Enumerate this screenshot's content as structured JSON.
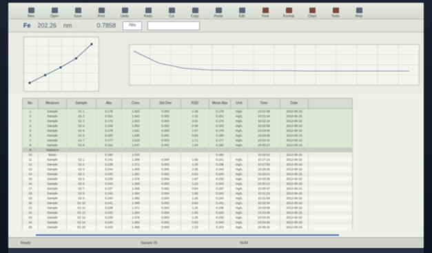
{
  "toolbar": {
    "tools": [
      {
        "label": "New",
        "icon": "new-icon"
      },
      {
        "label": "Open",
        "icon": "open-icon"
      },
      {
        "label": "Save",
        "icon": "save-icon"
      },
      {
        "label": "Print",
        "icon": "print-icon"
      },
      {
        "label": "Undo",
        "icon": "undo-icon"
      },
      {
        "label": "Redo",
        "icon": "redo-icon"
      },
      {
        "label": "Cut",
        "icon": "cut-icon"
      },
      {
        "label": "Copy",
        "icon": "copy-icon"
      },
      {
        "label": "Paste",
        "icon": "paste-icon"
      },
      {
        "label": "Edit",
        "icon": "edit-icon"
      },
      {
        "label": "Find",
        "icon": "find-icon"
      },
      {
        "label": "Format",
        "icon": "format-icon"
      },
      {
        "label": "Chart",
        "icon": "chart-icon"
      },
      {
        "label": "Tools",
        "icon": "tools-icon"
      },
      {
        "label": "Help",
        "icon": "help-icon"
      }
    ]
  },
  "formula": {
    "cell": "Fe",
    "value1": "202.26",
    "unit": "nm",
    "value2": "0.7858",
    "box": "Abs"
  },
  "chart1": {
    "points": [
      [
        1,
        1.2
      ],
      [
        2,
        1.8
      ],
      [
        3,
        2.4
      ],
      [
        4,
        3.1
      ],
      [
        5,
        4.2
      ]
    ]
  },
  "chart2": {
    "points": [
      [
        0,
        0.9
      ],
      [
        1,
        0.55
      ],
      [
        2,
        0.4
      ],
      [
        3,
        0.35
      ],
      [
        4,
        0.34
      ],
      [
        5,
        0.33
      ],
      [
        6,
        0.33
      ],
      [
        7,
        0.32
      ],
      [
        8,
        0.32
      ],
      [
        9,
        0.32
      ],
      [
        10,
        0.32
      ],
      [
        11,
        0.32
      ]
    ]
  },
  "table": {
    "headers": [
      "No.",
      "Measure",
      "Sample",
      "Abs",
      "Conc",
      "Std Dev",
      "RSD",
      "Mean Abs",
      "Unit",
      "Time",
      "Date"
    ],
    "rows": [
      [
        "1",
        "Sample",
        "S1 1",
        "0.178",
        "1.025",
        "0.003",
        "1.45",
        "0.178",
        "mg/L",
        "10:21:08",
        "2012-06-15"
      ],
      [
        "2",
        "Sample",
        "S1 2",
        "0.181",
        "1.042",
        "0.002",
        "1.12",
        "0.181",
        "mg/L",
        "10:21:44",
        "2012-06-15"
      ],
      [
        "3",
        "Sample",
        "S1 3",
        "0.176",
        "1.013",
        "0.004",
        "2.01",
        "0.176",
        "mg/L",
        "10:22:19",
        "2012-06-15"
      ],
      [
        "4",
        "Sample",
        "S1 4",
        "0.183",
        "1.053",
        "0.002",
        "0.98",
        "0.183",
        "mg/L",
        "10:22:55",
        "2012-06-15"
      ],
      [
        "5",
        "Sample",
        "S1 5",
        "0.179",
        "1.031",
        "0.003",
        "1.57",
        "0.179",
        "mg/L",
        "10:23:30",
        "2012-06-15"
      ],
      [
        "6",
        "Sample",
        "S1 6",
        "0.180",
        "1.036",
        "0.001",
        "0.66",
        "0.180",
        "mg/L",
        "10:24:06",
        "2012-06-15"
      ],
      [
        "7",
        "Sample",
        "S1 7",
        "0.177",
        "1.019",
        "0.003",
        "1.71",
        "0.177",
        "mg/L",
        "10:24:41",
        "2012-06-15"
      ],
      [
        "8",
        "Sample",
        "S1 8",
        "0.182",
        "1.047",
        "0.002",
        "1.08",
        "0.182",
        "mg/L",
        "10:25:17",
        "2012-06-15"
      ],
      [
        "9",
        "Statistics",
        "",
        "",
        "",
        "",
        "",
        "",
        "",
        "",
        ""
      ],
      [
        "10",
        "Mean",
        "",
        "0.180",
        "1.033",
        "",
        "",
        "0.180",
        "",
        "10:26:02",
        "2012-06-15"
      ],
      [
        "11",
        "Sample",
        "S2 1",
        "0.241",
        "1.388",
        "0.004",
        "1.66",
        "0.241",
        "mg/L",
        "10:27:14",
        "2012-06-15"
      ],
      [
        "12",
        "Sample",
        "S2 2",
        "0.238",
        "1.371",
        "0.003",
        "1.26",
        "0.238",
        "mg/L",
        "10:27:50",
        "2012-06-15"
      ],
      [
        "13",
        "Sample",
        "S2 3",
        "0.244",
        "1.405",
        "0.005",
        "2.05",
        "0.244",
        "mg/L",
        "10:28:25",
        "2012-06-15"
      ],
      [
        "14",
        "Sample",
        "S2 4",
        "0.240",
        "1.382",
        "0.002",
        "0.83",
        "0.240",
        "mg/L",
        "10:29:01",
        "2012-06-15"
      ],
      [
        "15",
        "Sample",
        "S2 5",
        "0.239",
        "1.376",
        "0.004",
        "1.67",
        "0.239",
        "mg/L",
        "10:29:36",
        "2012-06-15"
      ],
      [
        "16",
        "Sample",
        "S2 6",
        "0.243",
        "1.399",
        "0.003",
        "1.23",
        "0.243",
        "mg/L",
        "10:30:12",
        "2012-06-15"
      ],
      [
        "17",
        "Sample",
        "S2 7",
        "0.237",
        "1.365",
        "0.002",
        "0.84",
        "0.237",
        "mg/L",
        "10:30:47",
        "2012-06-15"
      ],
      [
        "18",
        "Sample",
        "S2 8",
        "0.242",
        "1.394",
        "0.004",
        "1.65",
        "0.242",
        "mg/L",
        "10:31:23",
        "2012-06-15"
      ],
      [
        "19",
        "Sample",
        "S2 9",
        "0.240",
        "1.382",
        "0.003",
        "1.25",
        "0.240",
        "mg/L",
        "10:31:58",
        "2012-06-15"
      ],
      [
        "20",
        "Sample",
        "S2 10",
        "0.241",
        "1.388",
        "0.002",
        "0.83",
        "0.241",
        "mg/L",
        "10:32:34",
        "2012-06-15"
      ],
      [
        "21",
        "Sample",
        "S2 11",
        "0.238",
        "1.371",
        "0.003",
        "1.26",
        "0.238",
        "mg/L",
        "10:33:09",
        "2012-06-15"
      ],
      [
        "22",
        "Sample",
        "S2 12",
        "0.242",
        "1.394",
        "0.004",
        "1.65",
        "0.242",
        "mg/L",
        "10:33:45",
        "2012-06-15"
      ],
      [
        "23",
        "Sample",
        "S2 13",
        "0.239",
        "1.376",
        "0.003",
        "1.26",
        "0.239",
        "mg/L",
        "10:34:20",
        "2012-06-15"
      ],
      [
        "24",
        "Sample",
        "S2 14",
        "0.240",
        "1.382",
        "0.002",
        "0.83",
        "0.240",
        "mg/L",
        "10:34:56",
        "2012-06-15"
      ],
      [
        "25",
        "Sample",
        "S2 15",
        "0.243",
        "1.399",
        "0.003",
        "1.23",
        "0.243",
        "mg/L",
        "10:35:31",
        "2012-06-15"
      ]
    ]
  },
  "status": {
    "left": "Ready",
    "mid": "Sample 25",
    "right": "NUM"
  }
}
